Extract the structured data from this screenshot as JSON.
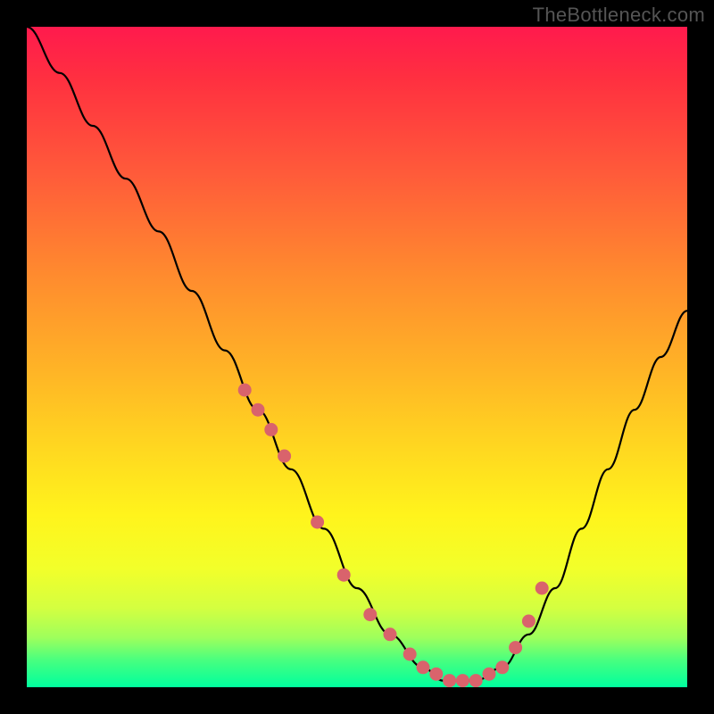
{
  "watermark": "TheBottleneck.com",
  "chart_data": {
    "type": "line",
    "title": "",
    "xlabel": "",
    "ylabel": "",
    "xlim": [
      0,
      100
    ],
    "ylim": [
      0,
      100
    ],
    "grid": false,
    "legend": false,
    "series": [
      {
        "name": "bottleneck-curve",
        "x": [
          0,
          5,
          10,
          15,
          20,
          25,
          30,
          35,
          40,
          45,
          50,
          55,
          60,
          63,
          68,
          72,
          76,
          80,
          84,
          88,
          92,
          96,
          100
        ],
        "values": [
          100,
          93,
          85,
          77,
          69,
          60,
          51,
          42,
          33,
          24,
          15,
          8,
          3,
          1,
          1,
          3,
          8,
          15,
          24,
          33,
          42,
          50,
          57
        ]
      }
    ],
    "markers": {
      "name": "highlighted-range",
      "x": [
        33,
        35,
        37,
        39,
        44,
        48,
        52,
        55,
        58,
        60,
        62,
        64,
        66,
        68,
        70,
        72,
        74,
        76,
        78
      ],
      "values": [
        45,
        42,
        39,
        35,
        25,
        17,
        11,
        8,
        5,
        3,
        2,
        1,
        1,
        1,
        2,
        3,
        6,
        10,
        15
      ]
    },
    "background_gradient": {
      "top": "#ff1a4d",
      "middle": "#fff41c",
      "bottom": "#00ff9e"
    }
  }
}
